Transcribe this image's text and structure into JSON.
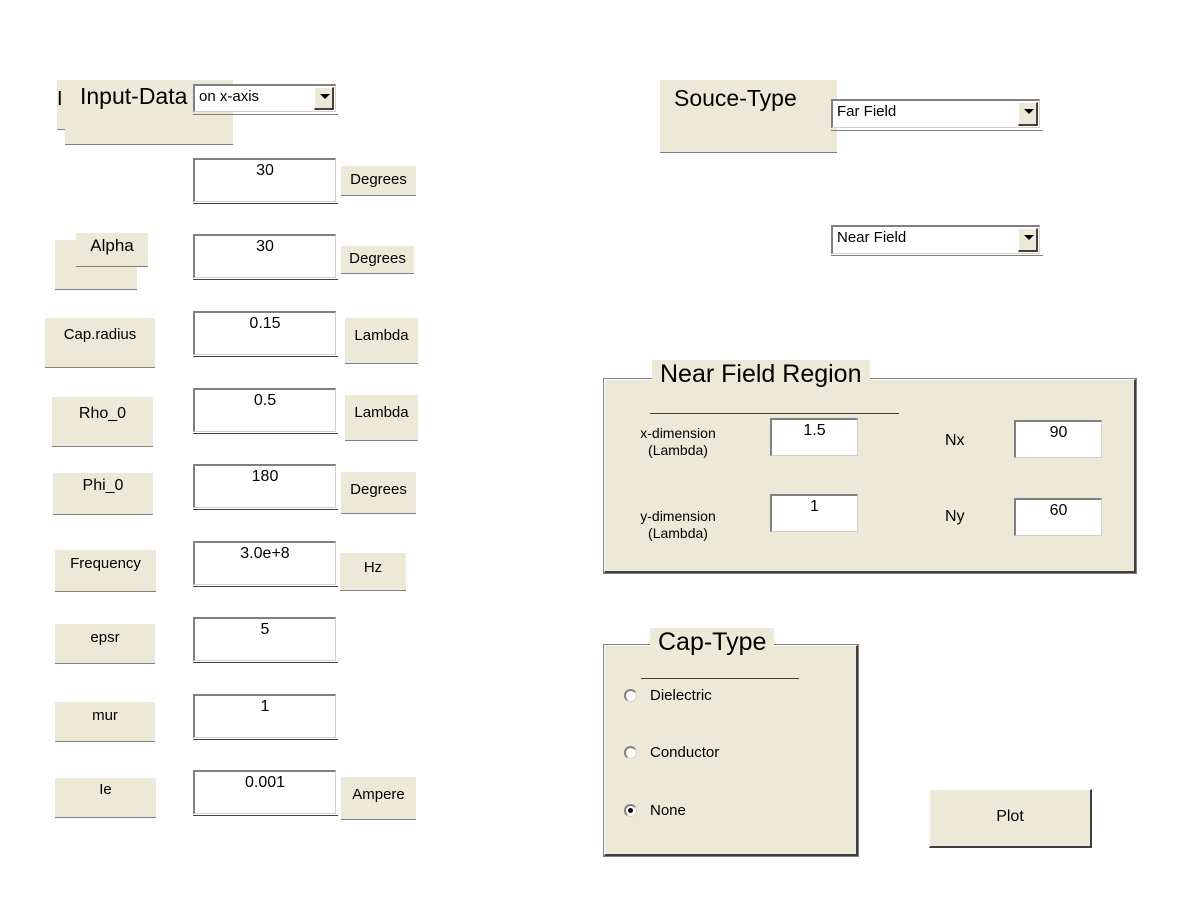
{
  "input_panel": {
    "title": "Input-Data",
    "partial_prefix": "I",
    "axis_select": {
      "value": "on x-axis"
    },
    "rows": [
      {
        "label": "",
        "value": "30",
        "unit": "Degrees"
      },
      {
        "label": "Alpha",
        "value": "30",
        "unit": "Degrees"
      },
      {
        "label": "Cap.radius",
        "value": "0.15",
        "unit": "Lambda"
      },
      {
        "label": "Rho_0",
        "value": "0.5",
        "unit": "Lambda"
      },
      {
        "label": "Phi_0",
        "value": "180",
        "unit": "Degrees"
      },
      {
        "label": "Frequency",
        "value": "3.0e+8",
        "unit": "Hz"
      },
      {
        "label": "epsr",
        "value": "5",
        "unit": ""
      },
      {
        "label": "mur",
        "value": "1",
        "unit": ""
      },
      {
        "label": "Ie",
        "value": "0.001",
        "unit": "Ampere"
      }
    ]
  },
  "source_type": {
    "title": "Souce-Type",
    "far_field_select": {
      "value": "Far Field"
    },
    "near_field_select": {
      "value": "Near Field"
    }
  },
  "near_field_region": {
    "title": "Near Field Region",
    "x_dimension_label": "x-dimension",
    "y_dimension_label": "y-dimension",
    "unit_label": "(Lambda)",
    "x_dimension_value": "1.5",
    "y_dimension_value": "1",
    "nx_label": "Nx",
    "nx_value": "90",
    "ny_label": "Ny",
    "ny_value": "60"
  },
  "cap_type": {
    "title": "Cap-Type",
    "options": [
      {
        "label": "Dielectric",
        "selected": false
      },
      {
        "label": "Conductor",
        "selected": false
      },
      {
        "label": "None",
        "selected": true
      }
    ]
  },
  "plot_button": {
    "label": "Plot"
  },
  "colors": {
    "panel_bg": "#ece9d8",
    "page_bg": "#ffffff"
  }
}
